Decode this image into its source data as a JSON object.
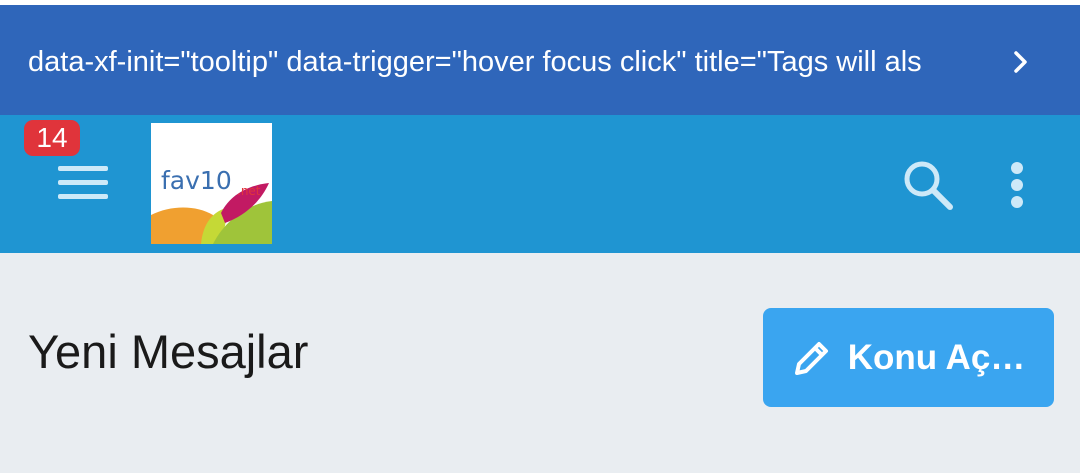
{
  "colors": {
    "notice_bg": "#2f66ba",
    "header_bg": "#1f95d2",
    "page_bg": "#e9edf1",
    "badge_bg": "#e0343b",
    "button_bg": "#3aa5f0",
    "icon_light": "#cde9f8"
  },
  "notice": {
    "text": "data-xf-init=\"tooltip\" data-trigger=\"hover focus click\" title=\"Tags will als",
    "next_icon": "chevron-right-icon"
  },
  "header": {
    "menu_icon": "hamburger-menu-icon",
    "badge_count": "14",
    "logo_text": "fav10",
    "logo_suffix": ".net",
    "search_icon": "search-icon",
    "more_icon": "more-vertical-icon"
  },
  "main": {
    "title": "Yeni Mesajlar",
    "new_thread_label": "Konu Aç…",
    "new_thread_icon": "pencil-icon"
  }
}
